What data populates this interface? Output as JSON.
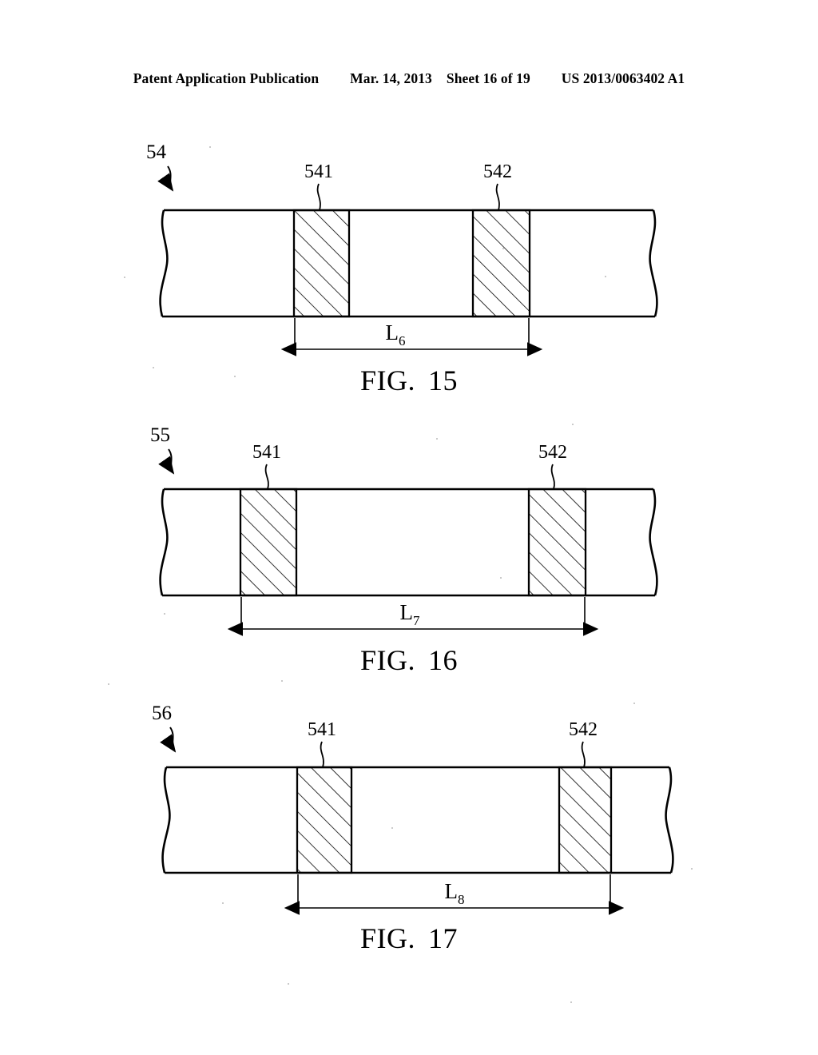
{
  "header": {
    "publication": "Patent Application Publication",
    "date": "Mar. 14, 2013",
    "sheet": "Sheet 16 of 19",
    "patent_number": "US 2013/0063402 A1"
  },
  "figures": [
    {
      "caption_prefix": "FIG.",
      "caption_number": "15",
      "assembly_ref": "54",
      "part_left_ref": "541",
      "part_right_ref": "542",
      "dimension_label": "L",
      "dimension_subscript": "6"
    },
    {
      "caption_prefix": "FIG.",
      "caption_number": "16",
      "assembly_ref": "55",
      "part_left_ref": "541",
      "part_right_ref": "542",
      "dimension_label": "L",
      "dimension_subscript": "7"
    },
    {
      "caption_prefix": "FIG.",
      "caption_number": "17",
      "assembly_ref": "56",
      "part_left_ref": "541",
      "part_right_ref": "542",
      "dimension_label": "L",
      "dimension_subscript": "8"
    }
  ],
  "style": {
    "ink": "#000000",
    "paper": "#ffffff"
  }
}
